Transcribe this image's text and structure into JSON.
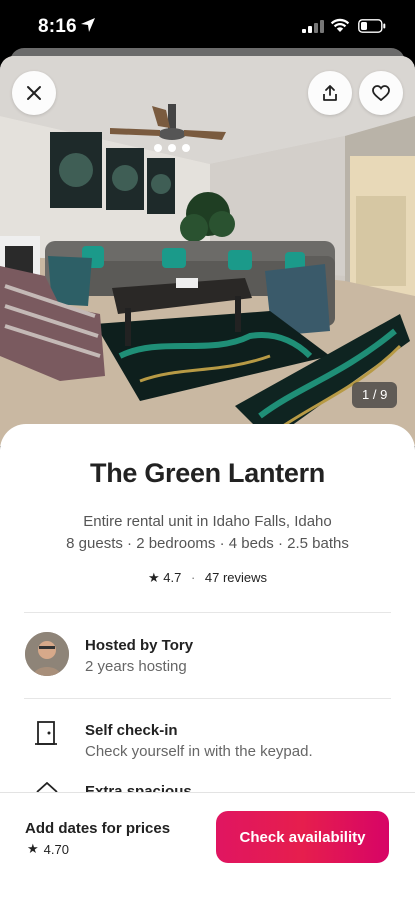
{
  "status": {
    "time": "8:16"
  },
  "listing": {
    "photo_counter": "1 / 9",
    "title": "The Green Lantern",
    "subtitle": "Entire rental unit in Idaho Falls, Idaho",
    "details": "8 guests · 2 bedrooms · 4 beds · 2.5 baths",
    "rating": "4.7",
    "reviews": "47 reviews"
  },
  "host": {
    "name": "Hosted by Tory",
    "years": "2 years hosting"
  },
  "highlights": [
    {
      "icon": "door-icon",
      "title": "Self check-in",
      "desc": "Check yourself in with the keypad."
    },
    {
      "icon": "house-icon",
      "title": "Extra spacious"
    }
  ],
  "footer": {
    "price_label": "Add dates for prices",
    "rating": "4.70",
    "cta": "Check availability"
  },
  "colors": {
    "accent": "#E61E4D",
    "text": "#222222",
    "muted": "#666666"
  }
}
